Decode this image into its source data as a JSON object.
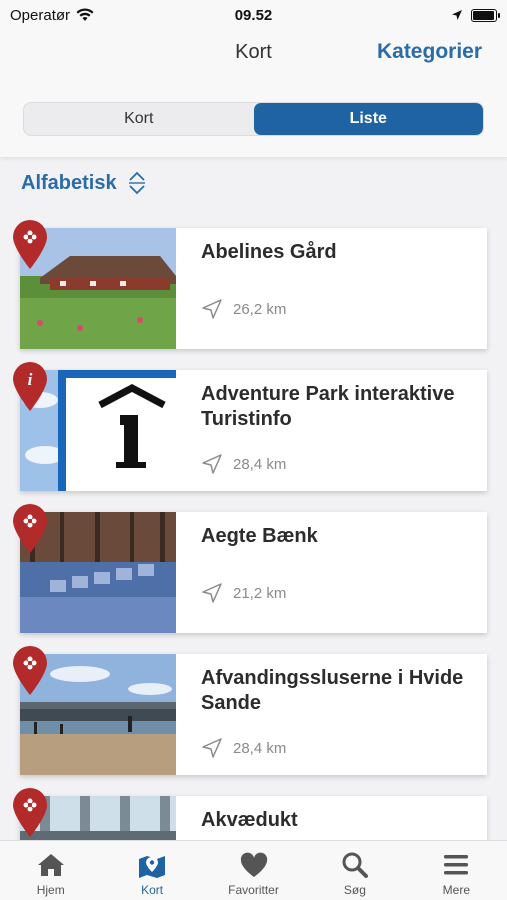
{
  "status": {
    "carrier": "Operatør",
    "time": "09.52",
    "battery_level": 0.95
  },
  "nav": {
    "title": "Kort",
    "action": "Kategorier"
  },
  "segments": [
    {
      "label": "Kort",
      "active": false
    },
    {
      "label": "Liste",
      "active": true
    }
  ],
  "sort": {
    "label": "Alfabetisk",
    "icon": "sort-updown-icon"
  },
  "items": [
    {
      "title": "Abelines Gård",
      "distance": "26,2 km",
      "pin": "flower-pin-icon"
    },
    {
      "title": "Adventure Park interaktive Turistinfo",
      "distance": "28,4 km",
      "pin": "info-pin-icon"
    },
    {
      "title": "Aegte Bænk",
      "distance": "21,2 km",
      "pin": "flower-pin-icon"
    },
    {
      "title": "Afvandingssluserne i Hvide Sande",
      "distance": "28,4 km",
      "pin": "flower-pin-icon"
    },
    {
      "title": "Akvædukt",
      "distance": "",
      "pin": "flower-pin-icon"
    }
  ],
  "tabs": [
    {
      "label": "Hjem",
      "icon": "home-icon",
      "active": false
    },
    {
      "label": "Kort",
      "icon": "map-icon",
      "active": true
    },
    {
      "label": "Favoritter",
      "icon": "heart-icon",
      "active": false
    },
    {
      "label": "Søg",
      "icon": "search-icon",
      "active": false
    },
    {
      "label": "Mere",
      "icon": "menu-icon",
      "active": false
    }
  ],
  "colors": {
    "accent": "#1f63a3",
    "pin": "#b22a2a"
  }
}
